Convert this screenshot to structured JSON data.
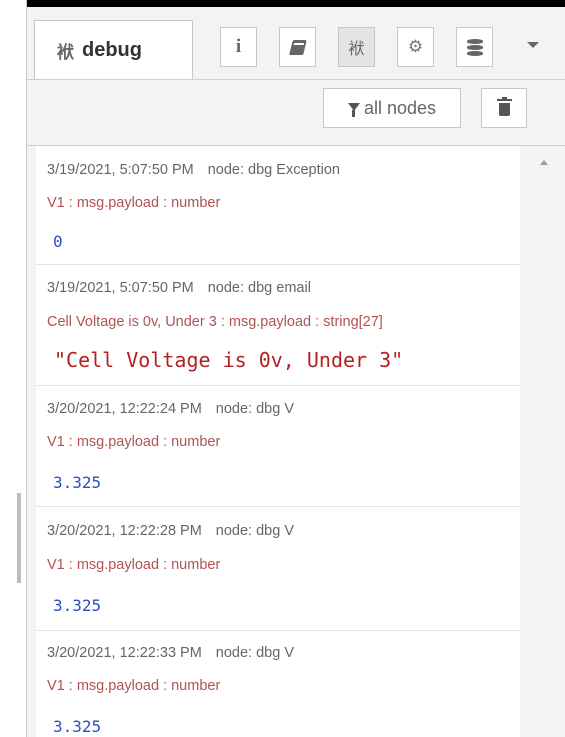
{
  "tabs": {
    "active_label": "debug",
    "buttons": [
      {
        "icon": "info-icon",
        "glyph": "i"
      },
      {
        "icon": "book-icon"
      },
      {
        "icon": "bug-icon",
        "glyph": "袱"
      },
      {
        "icon": "gear-icon",
        "glyph": "⚙"
      },
      {
        "icon": "database-icon"
      }
    ],
    "menu_icon": "caret-down-icon"
  },
  "toolbar": {
    "filter_label": "all nodes",
    "filter_icon": "filter-icon",
    "clear_icon": "trash-icon"
  },
  "messages": [
    {
      "timestamp": "3/19/2021, 5:07:50 PM",
      "node": "node: dbg Exception",
      "topic": "V1 : msg.payload : number",
      "value": "0"
    },
    {
      "timestamp": "3/19/2021, 5:07:50 PM",
      "node": "node: dbg email",
      "topic": "Cell Voltage is 0v, Under 3 : msg.payload : string[27]",
      "value": "\"Cell Voltage is 0v, Under 3\""
    },
    {
      "timestamp": "3/20/2021, 12:22:24 PM",
      "node": "node: dbg V",
      "topic": "V1 : msg.payload : number",
      "value": "3.325"
    },
    {
      "timestamp": "3/20/2021, 12:22:28 PM",
      "node": "node: dbg V",
      "topic": "V1 : msg.payload : number",
      "value": "3.325"
    },
    {
      "timestamp": "3/20/2021, 12:22:33 PM",
      "node": "node: dbg V",
      "topic": "V1 : msg.payload : number",
      "value": "3.325"
    }
  ],
  "colors": {
    "topic": "#b25252",
    "number_value": "#2c4fc2",
    "string_value": "#b22222",
    "meta_text": "#666666"
  }
}
